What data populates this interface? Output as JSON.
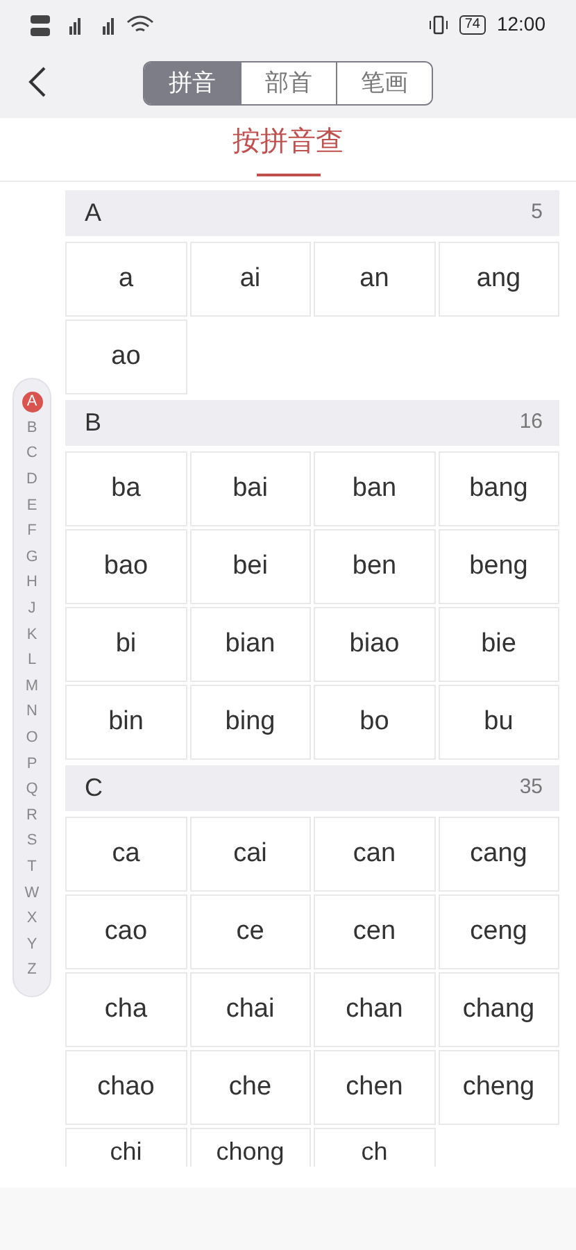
{
  "status_bar": {
    "time": "12:00",
    "battery": "74"
  },
  "tabs": [
    {
      "label": "拼音",
      "selected": true
    },
    {
      "label": "部首",
      "selected": false
    },
    {
      "label": "笔画",
      "selected": false
    }
  ],
  "title": "按拼音查",
  "sections": [
    {
      "letter": "A",
      "count": "5",
      "syllables": [
        "a",
        "ai",
        "an",
        "ang",
        "ao"
      ]
    },
    {
      "letter": "B",
      "count": "16",
      "syllables": [
        "ba",
        "bai",
        "ban",
        "bang",
        "bao",
        "bei",
        "ben",
        "beng",
        "bi",
        "bian",
        "biao",
        "bie",
        "bin",
        "bing",
        "bo",
        "bu"
      ]
    },
    {
      "letter": "C",
      "count": "35",
      "syllables": [
        "ca",
        "cai",
        "can",
        "cang",
        "cao",
        "ce",
        "cen",
        "ceng",
        "cha",
        "chai",
        "chan",
        "chang",
        "chao",
        "che",
        "chen",
        "cheng"
      ],
      "cut_row": [
        "chi",
        "chong",
        "ch"
      ]
    }
  ],
  "index": [
    {
      "label": "A",
      "selected": true
    },
    {
      "label": "B",
      "selected": false
    },
    {
      "label": "C",
      "selected": false
    },
    {
      "label": "D",
      "selected": false
    },
    {
      "label": "E",
      "selected": false
    },
    {
      "label": "F",
      "selected": false
    },
    {
      "label": "G",
      "selected": false
    },
    {
      "label": "H",
      "selected": false
    },
    {
      "label": "J",
      "selected": false
    },
    {
      "label": "K",
      "selected": false
    },
    {
      "label": "L",
      "selected": false
    },
    {
      "label": "M",
      "selected": false
    },
    {
      "label": "N",
      "selected": false
    },
    {
      "label": "O",
      "selected": false
    },
    {
      "label": "P",
      "selected": false
    },
    {
      "label": "Q",
      "selected": false
    },
    {
      "label": "R",
      "selected": false
    },
    {
      "label": "S",
      "selected": false
    },
    {
      "label": "T",
      "selected": false
    },
    {
      "label": "W",
      "selected": false
    },
    {
      "label": "X",
      "selected": false
    },
    {
      "label": "Y",
      "selected": false
    },
    {
      "label": "Z",
      "selected": false
    }
  ]
}
